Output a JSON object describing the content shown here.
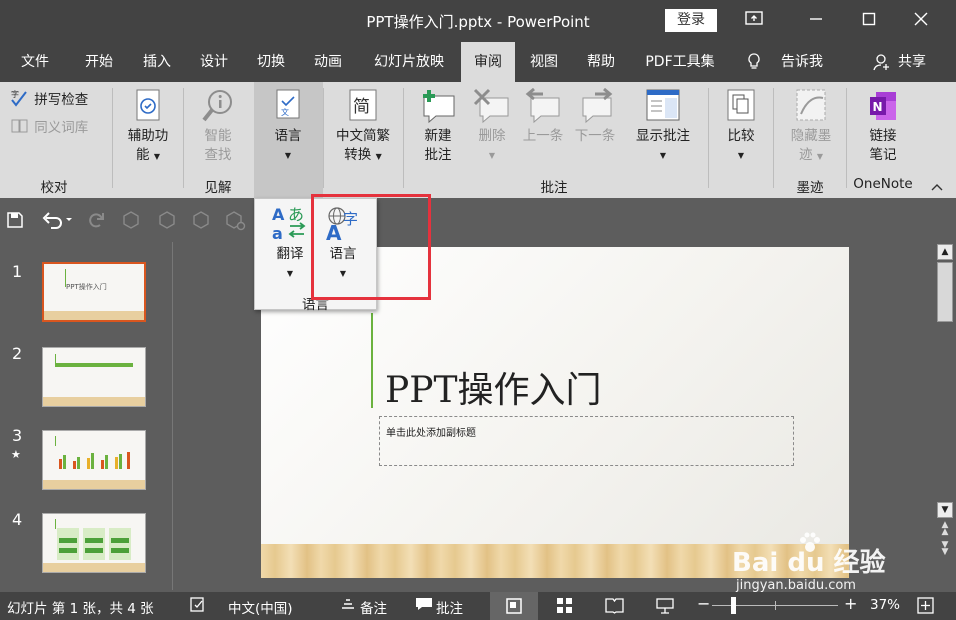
{
  "titlebar": {
    "title": "PPT操作入门.pptx - PowerPoint",
    "login": "登录"
  },
  "menu": {
    "tabs": [
      "文件",
      "开始",
      "插入",
      "设计",
      "切换",
      "动画",
      "幻灯片放映",
      "审阅",
      "视图",
      "帮助",
      "PDF工具集"
    ],
    "tell": "告诉我",
    "share": "共享"
  },
  "ribbon": {
    "spell": "拼写检查",
    "thesaurus": "同义词库",
    "g_proof": "校对",
    "access1": "辅助功",
    "access2": "能",
    "smart1": "智能",
    "smart2": "查找",
    "g_insights": "见解",
    "lang": "语言",
    "conv1": "中文简繁",
    "conv2": "转换",
    "newc1": "新建",
    "newc2": "批注",
    "del": "删除",
    "prev": "上一条",
    "next": "下一条",
    "show": "显示批注",
    "g_comments": "批注",
    "compare": "比较",
    "hide1": "隐藏墨",
    "hide2": "迹",
    "g_ink": "墨迹",
    "link1": "链接",
    "link2": "笔记",
    "g_onenote": "OneNote"
  },
  "dropdown": {
    "translate": "翻译",
    "language": "语言",
    "group": "语言"
  },
  "slides": {
    "nums": [
      "1",
      "2",
      "3",
      "4"
    ],
    "star": "★",
    "thumb1_title": "PPT操作入门"
  },
  "slide": {
    "title": "PPT操作入门",
    "subtitle": "单击此处添加副标题"
  },
  "status": {
    "slideinfo": "幻灯片 第 1 张，共 4 张",
    "lang": "中文(中国)",
    "notes": "备注",
    "comments": "批注",
    "zoom": "37%"
  },
  "watermark": {
    "brand": "Bai du 经验",
    "url": "jingyan.baidu.com"
  }
}
